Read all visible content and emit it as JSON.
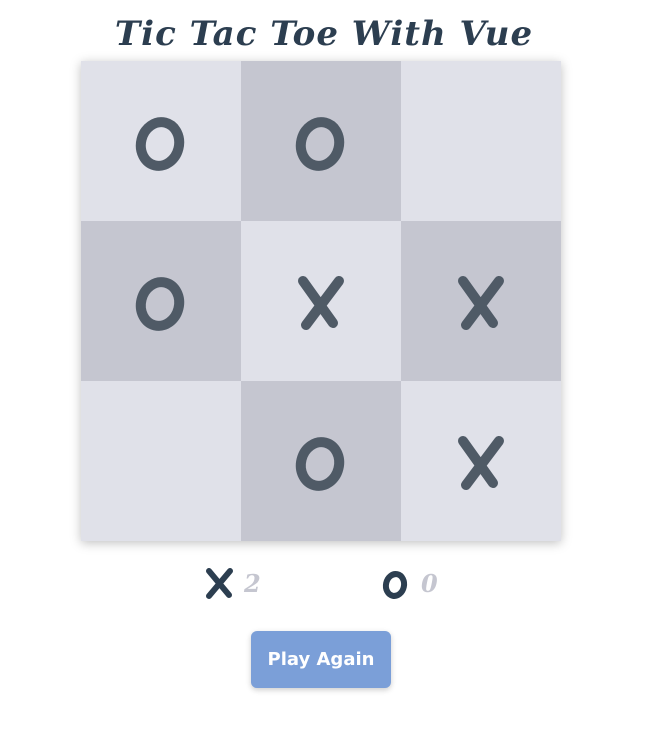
{
  "title": "Tic Tac Toe With Vue",
  "board": [
    "O",
    "O",
    "",
    "O",
    "X",
    "X",
    "",
    "O",
    "X"
  ],
  "score": {
    "x_label": "X",
    "x_count": "2",
    "o_label": "O",
    "o_count": "0"
  },
  "play_again_label": "Play Again",
  "colors": {
    "light_cell": "#e0e1e9",
    "dark_cell": "#c5c6d0",
    "mark": "#4f5a66",
    "button": "#7b9fd8",
    "title": "#2c3e50"
  }
}
